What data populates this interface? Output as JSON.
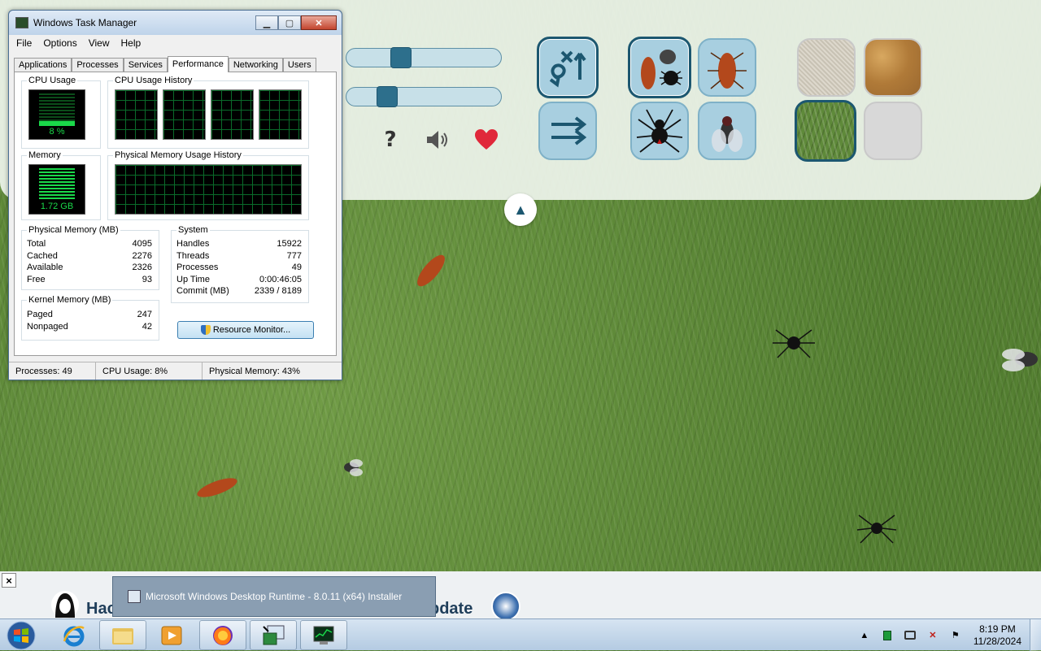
{
  "taskmgr": {
    "title": "Windows Task Manager",
    "menu": [
      "File",
      "Options",
      "View",
      "Help"
    ],
    "tabs": [
      "Applications",
      "Processes",
      "Services",
      "Performance",
      "Networking",
      "Users"
    ],
    "active_tab": "Performance",
    "cpu_usage_label": "CPU Usage",
    "cpu_usage_value": "8 %",
    "cpu_history_label": "CPU Usage History",
    "memory_label": "Memory",
    "memory_value": "1.72 GB",
    "phys_history_label": "Physical Memory Usage History",
    "physical_memory": {
      "title": "Physical Memory (MB)",
      "rows": [
        {
          "k": "Total",
          "v": "4095"
        },
        {
          "k": "Cached",
          "v": "2276"
        },
        {
          "k": "Available",
          "v": "2326"
        },
        {
          "k": "Free",
          "v": "93"
        }
      ]
    },
    "kernel_memory": {
      "title": "Kernel Memory (MB)",
      "rows": [
        {
          "k": "Paged",
          "v": "247"
        },
        {
          "k": "Nonpaged",
          "v": "42"
        }
      ]
    },
    "system": {
      "title": "System",
      "rows": [
        {
          "k": "Handles",
          "v": "15922"
        },
        {
          "k": "Threads",
          "v": "777"
        },
        {
          "k": "Processes",
          "v": "49"
        },
        {
          "k": "Up Time",
          "v": "0:00:46:05"
        },
        {
          "k": "Commit (MB)",
          "v": "2339 / 8189"
        }
      ]
    },
    "resource_monitor_label": "Resource Monitor...",
    "status": {
      "processes": "Processes: 49",
      "cpu": "CPU Usage: 8%",
      "memory": "Physical Memory: 43%"
    }
  },
  "game": {
    "speed_slider_level": 0.35,
    "count_slider_level": 0.27,
    "help_label": "?",
    "collapse_label": "▲"
  },
  "bottom": {
    "close_label": "×",
    "hack_text": "Hac",
    "update_text": "pdate",
    "tooltip_text": "Microsoft Windows Desktop Runtime - 8.0.11 (x64) Installer"
  },
  "taskbar": {
    "time": "8:19 PM",
    "date": "11/28/2024"
  },
  "colors": {
    "accent": "#1c5770",
    "tile": "#a8cfe0",
    "heart": "#e0283a"
  }
}
